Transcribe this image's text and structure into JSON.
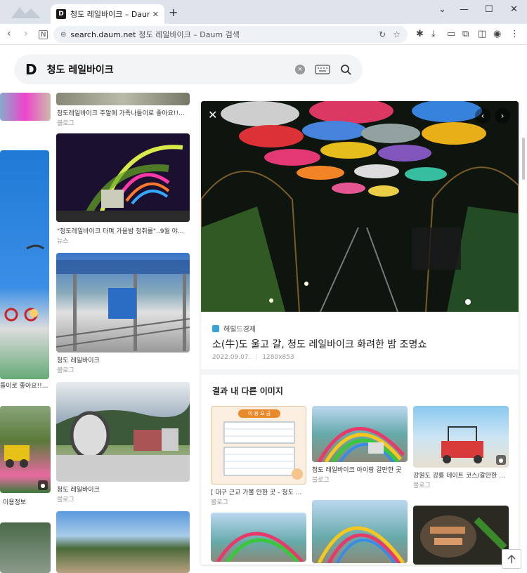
{
  "tab": {
    "favicon_letter": "D",
    "title": "청도 레일바이크 – Daum 검색"
  },
  "window": {
    "minimize": "—",
    "maximize": "☐",
    "close": "✕",
    "dropdown": "⌄",
    "new_tab": "+"
  },
  "address": {
    "host": "search.daum.net",
    "rest": "청도 레일바이크 – Daum 검색"
  },
  "search": {
    "logo": "D",
    "query": "청도 레일바이크",
    "clear": "×"
  },
  "left_column": {
    "partial_caption": "이용정보",
    "partial_caption2": "들이로 좋아요!!..."
  },
  "middle_column": [
    {
      "caption": "청도레일바이크 주말에 가족나들이로 좋아요!!...",
      "source": "블로그"
    },
    {
      "caption": "\"청도레일바이크 타며 가을밤 청취를\"..9월 야...",
      "source": "뉴스"
    },
    {
      "caption": "청도 레일바이크",
      "source": "블로그"
    },
    {
      "caption": "청도 레일바이크",
      "source": "블로그"
    }
  ],
  "detail": {
    "source": "헤럴드경제",
    "title": "소(牛)도 울고 갈, 청도 레일바이크 화려한 밤 조명쇼",
    "date": "2022.09.07.",
    "size": "1280x853",
    "close": "✕",
    "prev": "‹",
    "next": "›"
  },
  "related": {
    "heading": "결과 내 다른 이미지",
    "items": [
      {
        "caption": "[ 대구 근교 가볼 만한 곳 - 청도 ...",
        "source": "블로그",
        "badge": "이 용 요 금"
      },
      {
        "caption": "청도 레일바이크 아이랑 갈만한 곳",
        "source": "블로그"
      },
      {
        "caption": "강원도 강릉 데이트 코스/갈만한 ...",
        "source": "블로그"
      }
    ]
  },
  "colors": {
    "accent": "#39a3d9",
    "bg": "#ffffff",
    "tabbar": "#dfe3eb"
  }
}
